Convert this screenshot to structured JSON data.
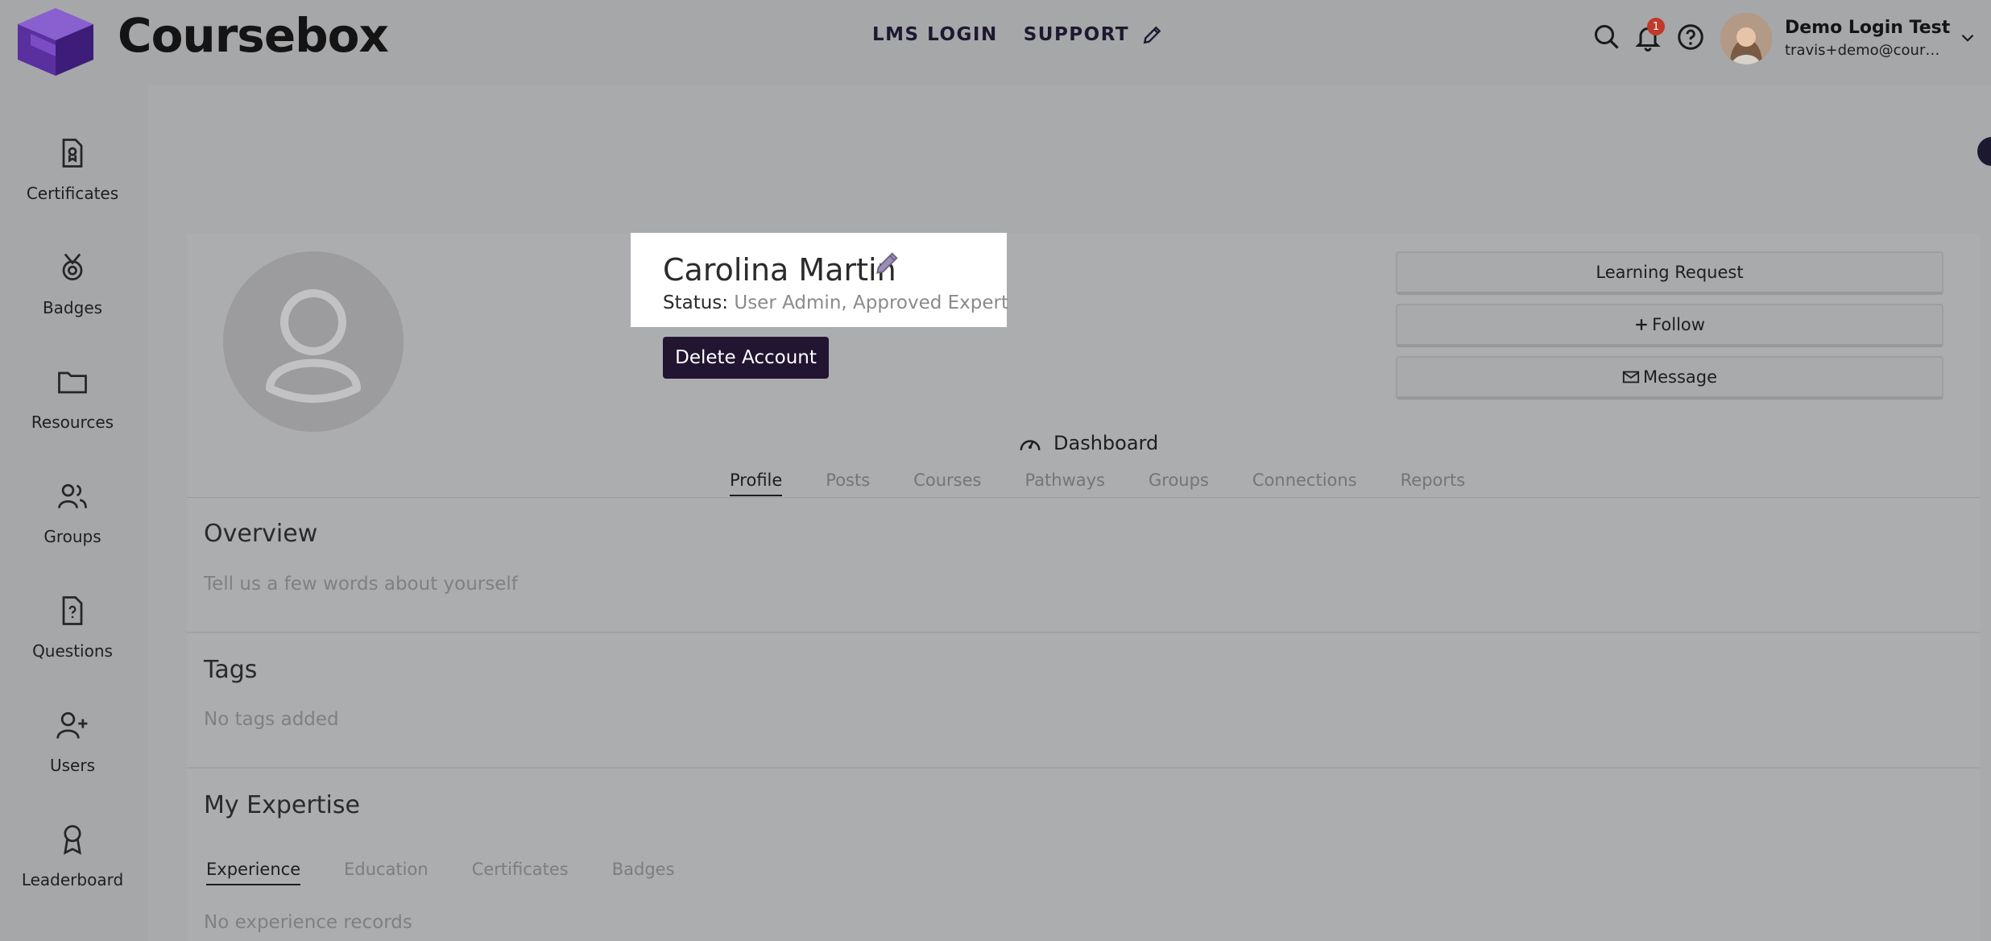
{
  "header": {
    "brand": "Coursebox",
    "nav": {
      "lms_login": "LMS LOGIN",
      "support": "SUPPORT"
    },
    "notification_count": "1",
    "user": {
      "name": "Demo Login Test",
      "email": "travis+demo@courseb..."
    }
  },
  "sidebar": {
    "items": [
      {
        "label": "Certificates",
        "icon": "certificate-icon"
      },
      {
        "label": "Badges",
        "icon": "badge-icon"
      },
      {
        "label": "Resources",
        "icon": "folder-icon"
      },
      {
        "label": "Groups",
        "icon": "groups-icon"
      },
      {
        "label": "Questions",
        "icon": "question-file-icon"
      },
      {
        "label": "Users",
        "icon": "add-user-icon"
      },
      {
        "label": "Leaderboard",
        "icon": "award-icon"
      }
    ]
  },
  "profile": {
    "name": "Carolina Martin",
    "status_label": "Status:",
    "status_value": "User Admin, Approved Expert",
    "delete_label": "Delete Account"
  },
  "actions": {
    "learning_request": "Learning Request",
    "follow": "Follow",
    "message": "Message"
  },
  "dashboard_label": "Dashboard",
  "tabs": [
    "Profile",
    "Posts",
    "Courses",
    "Pathways",
    "Groups",
    "Connections",
    "Reports"
  ],
  "overview": {
    "title": "Overview",
    "text": "Tell us a few words about yourself"
  },
  "tags": {
    "title": "Tags",
    "text": "No tags added"
  },
  "expertise": {
    "title": "My Expertise",
    "tabs": [
      "Experience",
      "Education",
      "Certificates",
      "Badges"
    ],
    "empty_text": "No experience records"
  },
  "colors": {
    "accent": "#211532",
    "logo_purple": "#6b3fb8",
    "highlight": "#ffffff"
  }
}
